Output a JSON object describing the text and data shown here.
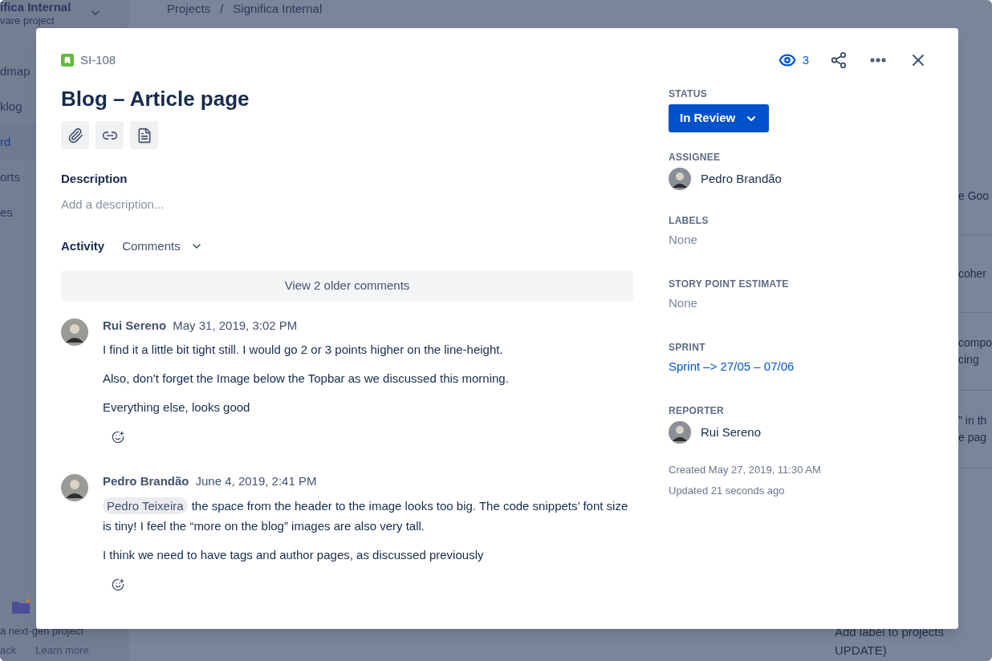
{
  "background": {
    "project": {
      "name": "ifica Internal",
      "type": "vare project"
    },
    "sidebar": {
      "items": [
        {
          "label": "dmap",
          "selected": false
        },
        {
          "label": "klog",
          "selected": false
        },
        {
          "label": "rd",
          "selected": true
        },
        {
          "label": "orts",
          "selected": false
        },
        {
          "label": "es",
          "selected": false
        }
      ],
      "promo": {
        "title": "a next-gen project",
        "links": [
          "ack",
          "Learn more"
        ]
      }
    },
    "breadcrumbs": [
      "Projects",
      "Significa Internal"
    ],
    "breadcrumb_separator": "/",
    "card_fragments": [
      [
        "e Goo"
      ],
      [
        "coher"
      ],
      [
        "compo",
        "cing"
      ],
      [
        "\" in th",
        "e pag"
      ]
    ],
    "bottom_card": [
      "Add label to projects",
      "UPDATE)"
    ]
  },
  "issue": {
    "key": "SI-108",
    "watchers": "3",
    "title": "Blog – Article page",
    "description": {
      "label": "Description",
      "placeholder": "Add a description..."
    },
    "activity": {
      "label": "Activity",
      "filter": "Comments",
      "older": "View 2 older comments",
      "comments": [
        {
          "author": "Rui Sereno",
          "time": "May 31, 2019, 3:02 PM",
          "paragraphs": [
            {
              "text": "I find it a little bit tight still. I would go 2 or 3 points higher on the line-height."
            },
            {
              "text": "Also, don’t forget the Image below the Topbar as we discussed this morning."
            },
            {
              "text": "Everything else, looks good"
            }
          ]
        },
        {
          "author": "Pedro Brandão",
          "time": "June 4, 2019, 2:41 PM",
          "paragraphs": [
            {
              "mention": "Pedro Teixeira",
              "text": "the space from the header to the image looks too big. The code snippets’ font size is tiny! I feel the “more on the blog” images are also very tall."
            },
            {
              "text": "I think we need to have tags and author pages, as discussed previously"
            }
          ]
        }
      ]
    },
    "fields": [
      {
        "kind": "status",
        "label": "STATUS",
        "value": "In Review"
      },
      {
        "kind": "user",
        "label": "ASSIGNEE",
        "value": "Pedro Brandão"
      },
      {
        "kind": "text",
        "label": "LABELS",
        "value": "None"
      },
      {
        "kind": "text",
        "label": "STORY POINT ESTIMATE",
        "value": "None"
      },
      {
        "kind": "link",
        "label": "SPRINT",
        "value": "Sprint –> 27/05 – 07/06"
      },
      {
        "kind": "user",
        "label": "REPORTER",
        "value": "Rui Sereno"
      }
    ],
    "created": "Created May 27, 2019, 11:30 AM",
    "updated": "Updated 21 seconds ago"
  }
}
